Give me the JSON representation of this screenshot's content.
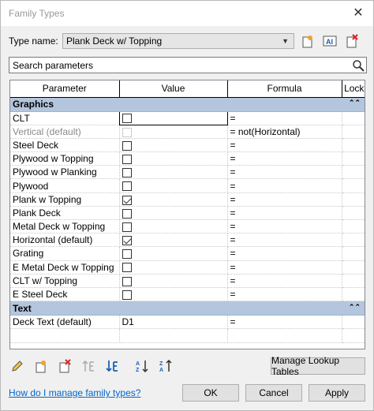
{
  "window": {
    "title": "Family Types"
  },
  "type_row": {
    "label": "Type name:",
    "selected": "Plank Deck w/ Topping"
  },
  "search": {
    "placeholder": "Search parameters"
  },
  "columns": [
    "Parameter",
    "Value",
    "Formula",
    "Lock"
  ],
  "groups": [
    {
      "name": "Graphics"
    },
    {
      "name": "Text"
    }
  ],
  "rows": {
    "clt": {
      "param": "CLT",
      "formula": "=",
      "checked": false
    },
    "vertical": {
      "param": "Vertical (default)",
      "formula": "= not(Horizontal)",
      "checked": false
    },
    "steel_deck": {
      "param": "Steel Deck",
      "formula": "=",
      "checked": false
    },
    "plywood_topping": {
      "param": "Plywood w Topping",
      "formula": "=",
      "checked": false
    },
    "plywood_planking": {
      "param": "Plywood w Planking",
      "formula": "=",
      "checked": false
    },
    "plywood": {
      "param": "Plywood",
      "formula": "=",
      "checked": false
    },
    "plank_topping": {
      "param": "Plank w Topping",
      "formula": "=",
      "checked": true
    },
    "plank_deck": {
      "param": "Plank Deck",
      "formula": "=",
      "checked": false
    },
    "metal_deck_topping": {
      "param": "Metal Deck w Topping",
      "formula": "=",
      "checked": false
    },
    "horizontal": {
      "param": "Horizontal (default)",
      "formula": "=",
      "checked": true
    },
    "grating": {
      "param": "Grating",
      "formula": "=",
      "checked": false
    },
    "e_metal_deck_topping": {
      "param": "E Metal Deck w Topping",
      "formula": "=",
      "checked": false
    },
    "clt_topping": {
      "param": "CLT w/ Topping",
      "formula": "=",
      "checked": false
    },
    "e_steel_deck": {
      "param": "E Steel Deck",
      "formula": "=",
      "checked": false
    },
    "deck_text": {
      "param": "Deck Text (default)",
      "value": "D1",
      "formula": "="
    }
  },
  "buttons": {
    "manage_lookup": "Manage Lookup Tables",
    "ok": "OK",
    "cancel": "Cancel",
    "apply": "Apply"
  },
  "help_link": "How do I manage family types?"
}
